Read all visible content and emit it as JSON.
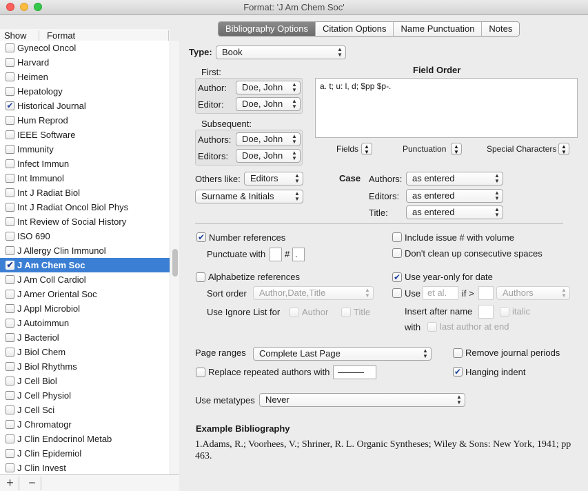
{
  "window": {
    "title": "Format: 'J Am Chem Soc'"
  },
  "sidebar": {
    "header_show": "Show",
    "header_format": "Format",
    "items": [
      {
        "label": "Gynecol Oncol",
        "checked": false
      },
      {
        "label": "Harvard",
        "checked": false
      },
      {
        "label": "Heimen",
        "checked": false
      },
      {
        "label": "Hepatology",
        "checked": false
      },
      {
        "label": "Historical Journal",
        "checked": true
      },
      {
        "label": "Hum Reprod",
        "checked": false
      },
      {
        "label": "IEEE Software",
        "checked": false
      },
      {
        "label": "Immunity",
        "checked": false
      },
      {
        "label": "Infect Immun",
        "checked": false
      },
      {
        "label": "Int Immunol",
        "checked": false
      },
      {
        "label": "Int J Radiat Biol",
        "checked": false
      },
      {
        "label": "Int J Radiat Oncol Biol Phys",
        "checked": false
      },
      {
        "label": "Int Review of Social History",
        "checked": false
      },
      {
        "label": "ISO 690",
        "checked": false
      },
      {
        "label": "J Allergy Clin Immunol",
        "checked": false
      },
      {
        "label": "J Am Chem Soc",
        "checked": true,
        "selected": true
      },
      {
        "label": "J Am Coll Cardiol",
        "checked": false
      },
      {
        "label": "J Amer Oriental Soc",
        "checked": false
      },
      {
        "label": "J Appl Microbiol",
        "checked": false
      },
      {
        "label": "J Autoimmun",
        "checked": false
      },
      {
        "label": "J Bacteriol",
        "checked": false
      },
      {
        "label": "J Biol Chem",
        "checked": false
      },
      {
        "label": "J Biol Rhythms",
        "checked": false
      },
      {
        "label": "J Cell Biol",
        "checked": false
      },
      {
        "label": "J Cell Physiol",
        "checked": false
      },
      {
        "label": "J Cell Sci",
        "checked": false
      },
      {
        "label": "J Chromatogr",
        "checked": false
      },
      {
        "label": "J Clin Endocrinol Metab",
        "checked": false
      },
      {
        "label": "J Clin Epidemiol",
        "checked": false
      },
      {
        "label": "J Clin Invest",
        "checked": false
      }
    ],
    "add_label": "+",
    "remove_label": "−"
  },
  "tabs": [
    "Bibliography Options",
    "Citation Options",
    "Name Punctuation",
    "Notes"
  ],
  "active_tab": "Bibliography Options",
  "options": {
    "type_label": "Type:",
    "type_value": "Book",
    "first_label": "First:",
    "author_label": "Author:",
    "author_value": "Doe, John",
    "editor_label": "Editor:",
    "editor_value": "Doe, John",
    "subsequent_label": "Subsequent:",
    "authors_label": "Authors:",
    "authors_value": "Doe, John",
    "editors_label": "Editors:",
    "editors_value": "Doe, John",
    "others_like_label": "Others like:",
    "others_like_value": "Editors",
    "name_format_value": "Surname & Initials",
    "field_order_title": "Field Order",
    "field_order_value": "a. t; u: l, d; $pp $p-.",
    "fields_label": "Fields",
    "punctuation_label": "Punctuation",
    "special_chars_label": "Special Characters",
    "case_label": "Case",
    "case_authors_label": "Authors:",
    "case_authors_value": "as entered",
    "case_editors_label": "Editors:",
    "case_editors_value": "as entered",
    "case_title_label": "Title:",
    "case_title_value": "as entered",
    "number_refs_label": "Number references",
    "number_refs_checked": true,
    "punctuate_with_label": "Punctuate with",
    "punct_before": "",
    "punct_hash": "#",
    "punct_after": ".",
    "include_issue_label": "Include issue # with volume",
    "include_issue_checked": false,
    "dont_clean_label": "Don't clean up consecutive spaces",
    "dont_clean_checked": false,
    "alphabetize_label": "Alphabetize references",
    "alphabetize_checked": false,
    "sort_order_label": "Sort order",
    "sort_order_value": "Author,Date,Title",
    "use_ignore_label": "Use Ignore List for",
    "ignore_author_label": "Author",
    "ignore_title_label": "Title",
    "year_only_label": "Use year-only for date",
    "year_only_checked": true,
    "use_label": "Use",
    "etal_placeholder": "et al.",
    "if_gt_label": "if >",
    "etal_authors_value": "Authors",
    "insert_after_label": "Insert after name",
    "italic_label": "italic",
    "with_label": "with",
    "last_author_label": "last author at end",
    "page_ranges_label": "Page ranges",
    "page_ranges_value": "Complete Last Page",
    "remove_periods_label": "Remove journal periods",
    "remove_periods_checked": false,
    "replace_repeated_label": "Replace repeated authors with",
    "hanging_indent_label": "Hanging indent",
    "hanging_indent_checked": true,
    "use_metatypes_label": "Use metatypes",
    "use_metatypes_value": "Never",
    "example_title": "Example Bibliography",
    "example_text": "1.Adams, R.; Voorhees, V.; Shriner, R. L. Organic Syntheses; Wiley & Sons: New York, 1941; pp 463."
  },
  "colors": {
    "selection": "#3b7fd4",
    "active_tab": "#7a7a7a",
    "check": "#1b3f9a"
  }
}
